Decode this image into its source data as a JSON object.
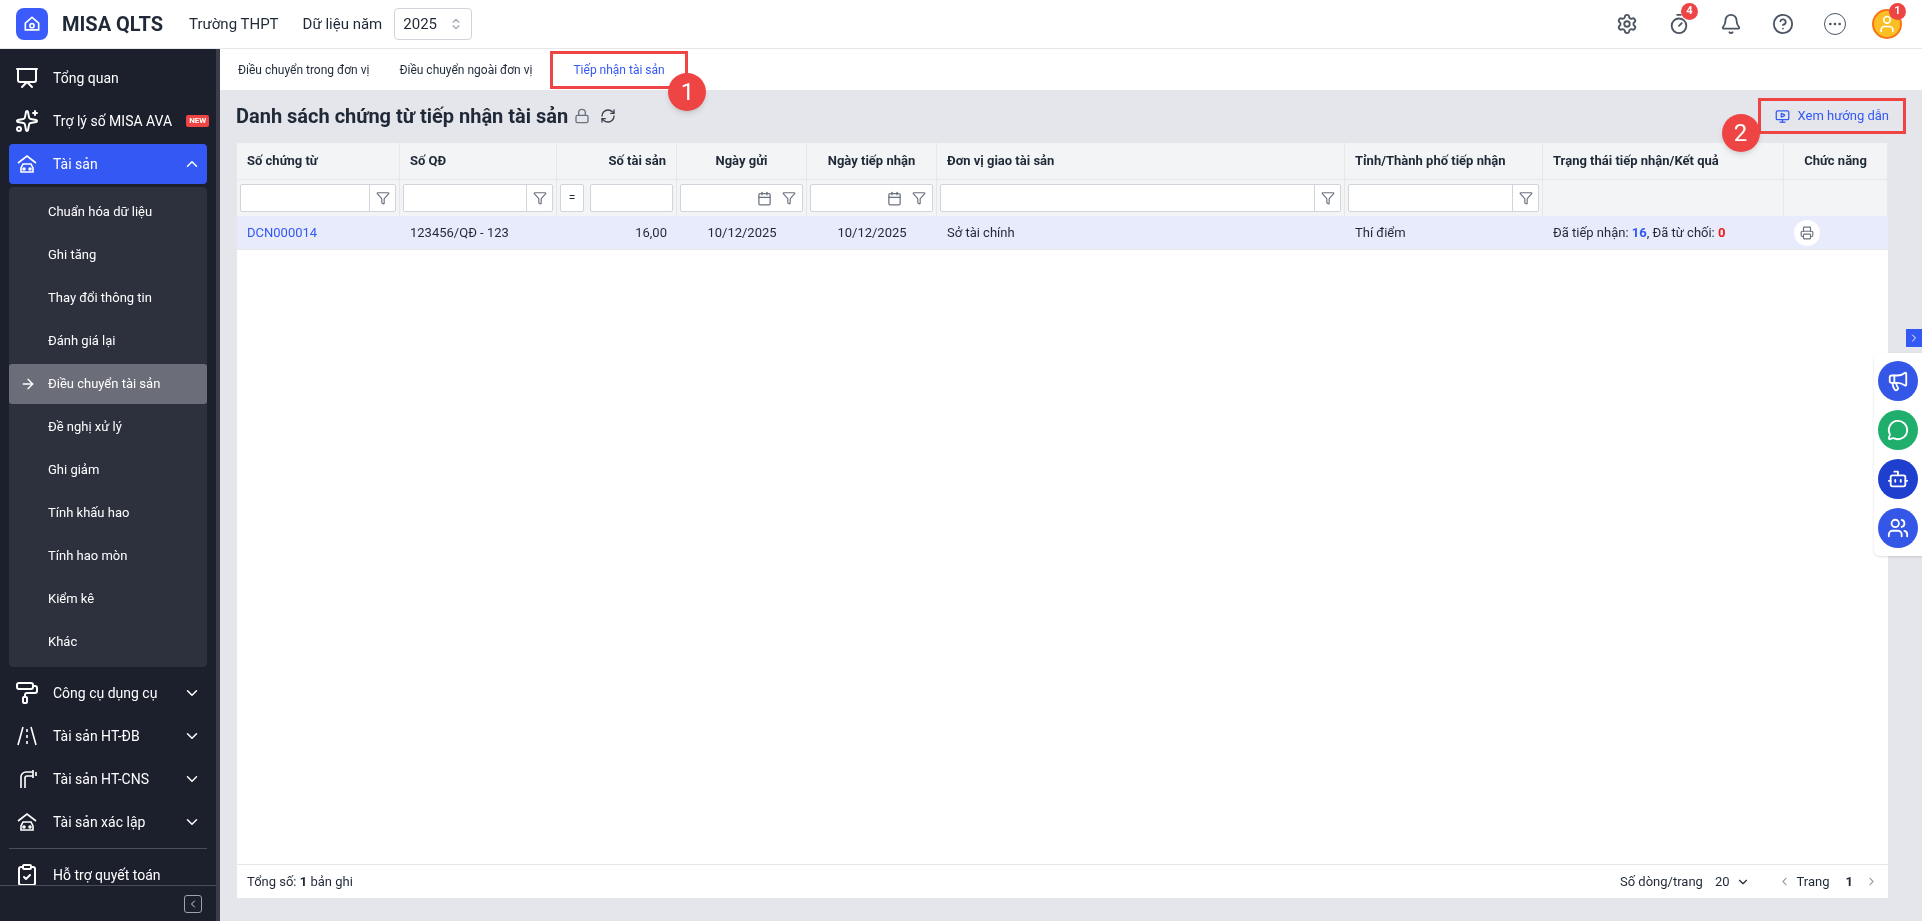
{
  "app": {
    "name": "MISA QLTS",
    "unit": "Trường THPT",
    "year_label": "Dữ liệu năm",
    "year": "2025"
  },
  "header_icons": [
    {
      "kind": "settings"
    },
    {
      "kind": "timer",
      "badge": "4"
    },
    {
      "kind": "bell"
    },
    {
      "kind": "help"
    },
    {
      "kind": "more"
    },
    {
      "kind": "avatar",
      "badge": "1"
    }
  ],
  "sidebar": {
    "items": [
      {
        "kind": "overview",
        "label": "Tổng quan",
        "selected": false
      },
      {
        "kind": "sparkle",
        "label": "Trợ lý số MISA AVA",
        "badge": "NEW",
        "selected": false
      },
      {
        "kind": "house-car",
        "label": "Tài sản",
        "selected": true,
        "expanded": true,
        "children": [
          {
            "label": "Chuẩn hóa dữ liệu",
            "selected": false
          },
          {
            "label": "Ghi tăng",
            "selected": false
          },
          {
            "label": "Thay đổi thông tin",
            "selected": false
          },
          {
            "label": "Đánh giá lại",
            "selected": false
          },
          {
            "label": "Điều chuyển tài sản",
            "selected": true
          },
          {
            "label": "Đề nghị xử lý",
            "selected": false
          },
          {
            "label": "Ghi giảm",
            "selected": false
          },
          {
            "label": "Tính khấu hao",
            "selected": false
          },
          {
            "label": "Tính hao mòn",
            "selected": false
          },
          {
            "label": "Kiểm kê",
            "selected": false
          },
          {
            "label": "Khác",
            "selected": false
          }
        ]
      },
      {
        "kind": "roller",
        "label": "Công cụ dụng cụ",
        "selected": false,
        "expanded": false
      },
      {
        "kind": "road",
        "label": "Tài sản HT-ĐB",
        "selected": false,
        "expanded": false
      },
      {
        "kind": "pipe",
        "label": "Tài sản HT-CNS",
        "selected": false,
        "expanded": false
      },
      {
        "kind": "house-car",
        "label": "Tài sản xác lập",
        "selected": false,
        "expanded": false
      },
      {
        "kind": "clipboard",
        "label": "Hỗ trợ quyết toán",
        "selected": false
      }
    ]
  },
  "tabs": [
    {
      "label": "Điều chuyển trong đơn vị",
      "selected": false,
      "highlighted": false
    },
    {
      "label": "Điều chuyển ngoài đơn vị",
      "selected": false,
      "highlighted": false
    },
    {
      "label": "Tiếp nhận tài sản",
      "selected": true,
      "highlighted": true,
      "callout": "1"
    }
  ],
  "page": {
    "title": "Danh sách chứng từ tiếp nhận tài sản",
    "guide_button": {
      "label": "Xem hướng dẫn",
      "highlighted": true,
      "callout": "2"
    }
  },
  "table": {
    "columns": [
      {
        "label": "Số chứng từ",
        "kind": "text"
      },
      {
        "label": "Số QĐ",
        "kind": "text"
      },
      {
        "label": "Số tài sản",
        "kind": "number",
        "operator": "="
      },
      {
        "label": "Ngày gửi",
        "kind": "date"
      },
      {
        "label": "Ngày tiếp nhận",
        "kind": "date"
      },
      {
        "label": "Đơn vị giao tài sản",
        "kind": "text"
      },
      {
        "label": "Tỉnh/Thành phố tiếp nhận",
        "kind": "text"
      },
      {
        "label": "Trạng thái tiếp nhận/Kết quả",
        "kind": "none"
      },
      {
        "label": "Chức năng",
        "kind": "none"
      }
    ],
    "rows": [
      {
        "selected": true,
        "voucher": "DCN000014",
        "decision": "123456/QĐ - 123",
        "asset_count": "16,00",
        "sent_date": "10/12/2025",
        "received_date": "10/12/2025",
        "from_unit": "Sở tài chính",
        "province": "Thí điểm",
        "status": {
          "received_label": "Đã tiếp nhận:",
          "received": "16",
          "rejected_label": ", Đã từ chối:",
          "rejected": "0"
        }
      }
    ]
  },
  "footer": {
    "total": "Tổng số: **1** bản ghi",
    "page_size_label": "Số dòng/trang",
    "page_size": "20",
    "page_label": "Trang",
    "page": "1"
  },
  "side_widgets": [
    {
      "kind": "megaphone",
      "color": "#3557e8"
    },
    {
      "kind": "chat",
      "color": "#1fae6b"
    },
    {
      "kind": "robot",
      "color": "#1f3fcf"
    },
    {
      "kind": "people",
      "color": "#3557e8"
    }
  ]
}
